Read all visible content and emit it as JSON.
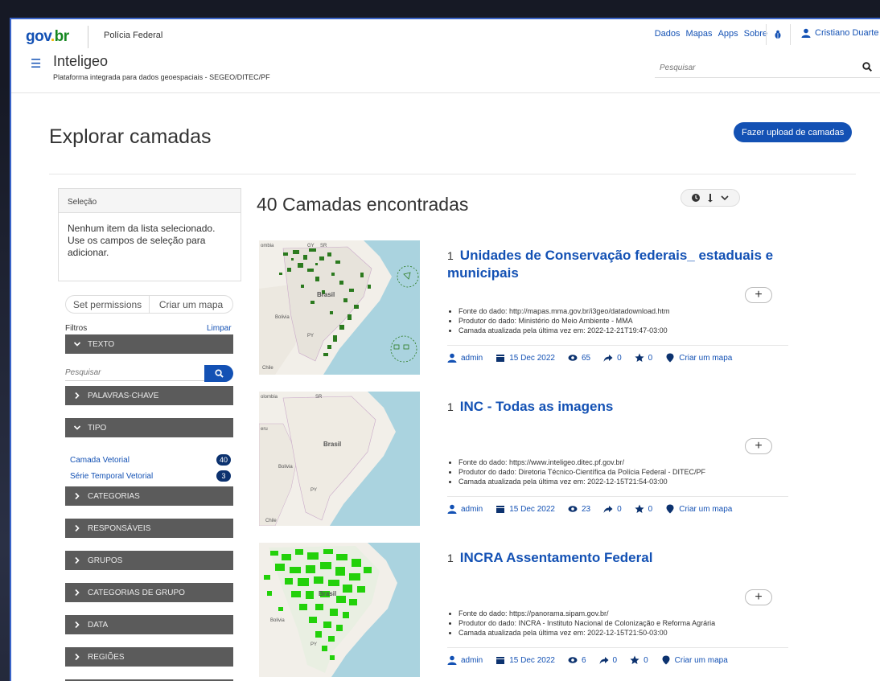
{
  "header": {
    "logo": {
      "g1": "gov",
      "dot": ".",
      "br": "br"
    },
    "org": "Polícia Federal",
    "links": [
      "Dados",
      "Mapas",
      "Apps",
      "Sobre"
    ],
    "user": "Cristiano Duarte",
    "app_title": "Inteligeo",
    "app_subtitle": "Plataforma integrada para dados geoespaciais - SEGEO/DITEC/PF",
    "search_placeholder": "Pesquisar"
  },
  "page": {
    "title": "Explorar camadas",
    "upload_button": "Fazer upload de camadas"
  },
  "sidebar": {
    "selection_title": "Seleção",
    "selection_text": "Nenhum item da lista selecionado. Use os campos de seleção para adicionar.",
    "set_permissions": "Set permissions",
    "create_map": "Criar um mapa",
    "filters_label": "Filtros",
    "clear_label": "Limpar",
    "search_placeholder": "Pesquisar",
    "facets": {
      "texto": "TEXTO",
      "palavras": "PALAVRAS-CHAVE",
      "tipo": "TIPO",
      "categorias": "CATEGORIAS",
      "responsaveis": "RESPONSÁVEIS",
      "grupos": "GRUPOS",
      "categorias_grupo": "CATEGORIAS DE GRUPO",
      "data": "DATA",
      "regioes": "REGIÕES"
    },
    "types": [
      {
        "label": "Camada Vetorial",
        "count": "40"
      },
      {
        "label": "Série Temporal Vetorial",
        "count": "3"
      }
    ]
  },
  "results": {
    "count_text": "40 Camadas encontradas",
    "items": [
      {
        "index": "1",
        "title": "Unidades de Conservação federais_ estaduais e municipais",
        "meta": [
          "Fonte do dado: http://mapas.mma.gov.br/i3geo/datadownload.htm",
          "Produtor do dado: Ministério do Meio Ambiente - MMA",
          "Camada atualizada pela última vez em: 2022-12-21T19:47-03:00"
        ],
        "owner": "admin",
        "date": "15 Dec 2022",
        "views": "65",
        "shares": "0",
        "stars": "0",
        "map_link": "Criar um mapa"
      },
      {
        "index": "1",
        "title": "INC - Todas as imagens",
        "meta": [
          "Fonte do dado: https://www.inteligeo.ditec.pf.gov.br/",
          "Produtor do dado: Diretoria Técnico-Científica da Polícia Federal - DITEC/PF",
          "Camada atualizada pela última vez em: 2022-12-15T21:54-03:00"
        ],
        "owner": "admin",
        "date": "15 Dec 2022",
        "views": "23",
        "shares": "0",
        "stars": "0",
        "map_link": "Criar um mapa"
      },
      {
        "index": "1",
        "title": "INCRA Assentamento Federal",
        "meta": [
          "Fonte do dado: https://panorama.sipam.gov.br/",
          "Produtor do dado: INCRA - Instituto Nacional de Colonização e Reforma Agrária",
          "Camada atualizada pela última vez em: 2022-12-15T21:50-03:00"
        ],
        "owner": "admin",
        "date": "15 Dec 2022",
        "views": "6",
        "shares": "0",
        "stars": "0",
        "map_link": "Criar um mapa"
      }
    ]
  },
  "map_labels": {
    "brasil": "Brasil",
    "bolivia": "Bolivia",
    "chile": "Chile",
    "py": "PY",
    "colombia": "Colombia",
    "colombia_partial": "olombia",
    "peru_partial": "eru",
    "gy": "GY",
    "sr": "SR",
    "ombia": "ombia"
  },
  "colors": {
    "brand_blue": "#1351b4",
    "facet_bg": "#5b5b5b",
    "badge_bg": "#0c326f",
    "map_green": "#2b7a1e",
    "map_bright_green": "#22d10a"
  },
  "icons": {
    "menu": "hamburger-icon",
    "search": "search-icon",
    "user": "user-icon",
    "bug": "bug-icon",
    "calendar": "calendar-icon",
    "views": "eye-icon",
    "share": "share-icon",
    "star": "star-icon",
    "pin": "map-pin-icon",
    "chevron_down": "chevron-down-icon",
    "chevron_right": "chevron-right-icon",
    "clock": "clock-icon",
    "sort": "sort-icon",
    "plus": "plus-icon"
  }
}
